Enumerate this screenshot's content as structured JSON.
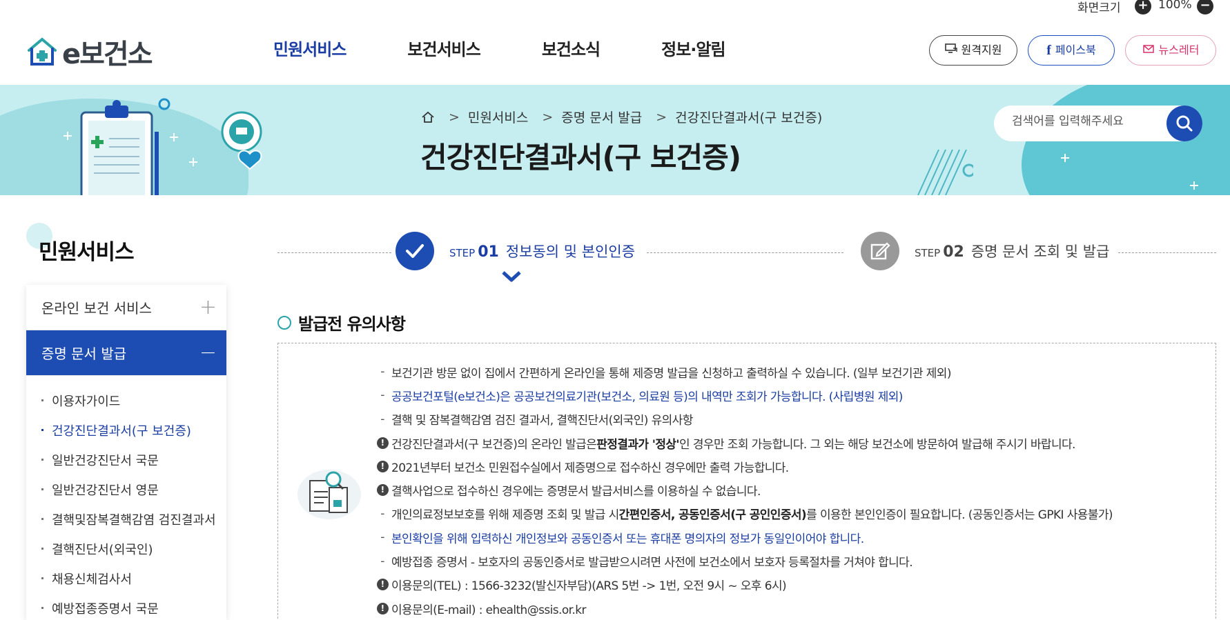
{
  "util": {
    "zoom_label": "화면크기",
    "zoom_value": "100%"
  },
  "header": {
    "logo_text": "e보건소",
    "nav": [
      "민원서비스",
      "보건서비스",
      "보건소식",
      "정보·알림"
    ],
    "buttons": {
      "remote": "원격지원",
      "facebook": "페이스북",
      "newsletter": "뉴스레터"
    }
  },
  "banner": {
    "breadcrumb": [
      "민원서비스",
      "증명 문서 발급",
      "건강진단결과서(구 보건증)"
    ],
    "title": "건강진단결과서(구 보건증)",
    "search_placeholder": "검색어를 입력해주세요"
  },
  "sidebar": {
    "title": "민원서비스",
    "groups": [
      {
        "label": "온라인 보건 서비스",
        "open": false
      },
      {
        "label": "증명 문서 발급",
        "open": true
      }
    ],
    "items": [
      "이용자가이드",
      "건강진단결과서(구 보건증)",
      "일반건강진단서 국문",
      "일반건강진단서 영문",
      "결핵및잠복결핵감염 검진결과서",
      "결핵진단서(외국인)",
      "채용신체검사서",
      "예방접종증명서 국문"
    ],
    "active_item": 1
  },
  "steps": [
    {
      "word": "STEP",
      "num": "01",
      "label": "정보동의 및 본인인증",
      "active": true
    },
    {
      "word": "STEP",
      "num": "02",
      "label": "증명 문서 조회 및 발급",
      "active": false
    }
  ],
  "notice": {
    "title": "발급전 유의사항",
    "lines": [
      {
        "type": "dash",
        "blue": false,
        "text": "보건기관 방문 없이 집에서 간편하게 온라인을 통해 제증명 발급을 신청하고 출력하실 수 있습니다. (일부 보건기관 제외)"
      },
      {
        "type": "dash",
        "blue": true,
        "text": "공공보건포털(e보건소)은 공공보건의료기관(보건소, 의료원 등)의 내역만 조회가 가능합니다. (사립병원 제외)"
      },
      {
        "type": "dash",
        "blue": false,
        "text": "결핵 및 잠복결핵감염 검진 결과서, 결핵진단서(외국인) 유의사항"
      },
      {
        "type": "ex",
        "blue": false,
        "pre": "건강진단결과서(구 보건증)의 온라인 발급은 ",
        "bold": "판정결과가 '정상'",
        "post": "인 경우만 조회 가능합니다. 그 외는 해당 보건소에 방문하여 발급해 주시기 바랍니다."
      },
      {
        "type": "ex",
        "blue": false,
        "text": "2021년부터 보건소 민원접수실에서 제증명으로 접수하신 경우에만 출력 가능합니다."
      },
      {
        "type": "ex",
        "blue": false,
        "text": "결핵사업으로 접수하신 경우에는 증명문서 발급서비스를 이용하실 수 없습니다."
      },
      {
        "type": "dash",
        "blue": false,
        "pre": "개인의료정보보호를 위해 제증명 조회 및 발급 시 ",
        "bold": "간편인증서, 공동인증서(구 공인인증서)",
        "post": "를 이용한 본인인증이 필요합니다. (공동인증서는 GPKI 사용불가)"
      },
      {
        "type": "dash",
        "blue": true,
        "text": "본인확인을 위해 입력하신 개인정보와 공동인증서 또는 휴대폰 명의자의 정보가 동일인이어야 합니다."
      },
      {
        "type": "dash",
        "blue": false,
        "text": "예방접종 증명서 - 보호자의 공동인증서로 발급받으시려면 사전에 보건소에서 보호자 등록절차를 거쳐야 합니다."
      },
      {
        "type": "ex",
        "blue": false,
        "text": "이용문의(TEL) : 1566-3232(발신자부담)(ARS 5번 -> 1번, 오전 9시 ~ 오후 6시)"
      },
      {
        "type": "ex",
        "blue": false,
        "text": "이용문의(E-mail) : ehealth@ssis.or.kr"
      }
    ]
  },
  "colors": {
    "primary": "#1d4db3",
    "banner_bg": "#c6eef0",
    "facebook": "#1a3da3",
    "newsletter": "#d6336c"
  }
}
